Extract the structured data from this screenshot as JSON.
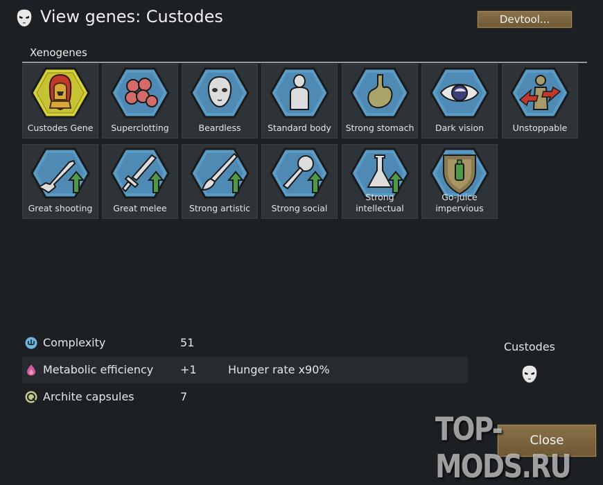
{
  "header": {
    "title": "View genes: Custodes",
    "devtool_label": "Devtool..."
  },
  "section": {
    "label": "Xenogenes"
  },
  "genes": [
    {
      "label": "Custodes Gene",
      "icon": "custodes-helmet-icon"
    },
    {
      "label": "Superclotting",
      "icon": "blood-cells-icon"
    },
    {
      "label": "Beardless",
      "icon": "face-icon"
    },
    {
      "label": "Standard body",
      "icon": "body-icon"
    },
    {
      "label": "Strong stomach",
      "icon": "stomach-icon"
    },
    {
      "label": "Dark vision",
      "icon": "eye-icon"
    },
    {
      "label": "Unstoppable",
      "icon": "unstoppable-icon"
    },
    {
      "label": "Great shooting",
      "icon": "rifle-icon"
    },
    {
      "label": "Great melee",
      "icon": "sword-icon"
    },
    {
      "label": "Strong artistic",
      "icon": "brush-icon"
    },
    {
      "label": "Strong social",
      "icon": "microphone-icon"
    },
    {
      "label": "Strong intellectual",
      "icon": "flask-icon"
    },
    {
      "label": "Go-juice impervious",
      "icon": "shield-icon"
    }
  ],
  "stats": [
    {
      "name": "Complexity",
      "value": "51",
      "desc": "",
      "icon": "complexity-icon"
    },
    {
      "name": "Metabolic efficiency",
      "value": "+1",
      "desc": "Hunger rate x90%",
      "icon": "metabolism-icon"
    },
    {
      "name": "Archite capsules",
      "value": "7",
      "desc": "",
      "icon": "archite-icon"
    }
  ],
  "xenotype": {
    "name": "Custodes",
    "icon": "xenotype-mask-icon"
  },
  "footer": {
    "close_label": "Close",
    "watermark": "TOP-MODS.RU"
  },
  "colors": {
    "hex_blue": "#5a9bc6",
    "hex_yellow": "#d6d23a",
    "arrow_green": "#4f9a4a",
    "button_brown": "#7c6540"
  }
}
